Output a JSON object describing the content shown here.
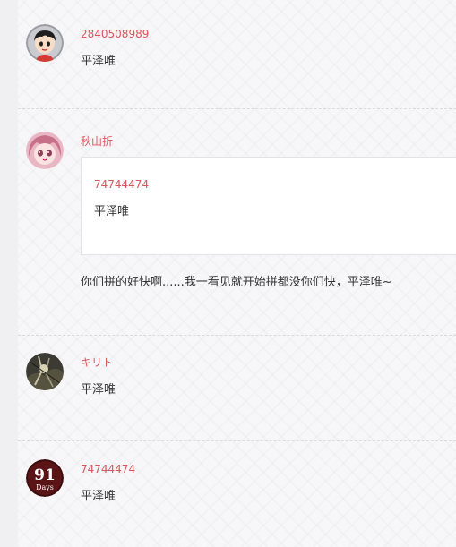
{
  "comments": [
    {
      "author": "2840508989",
      "text": "平泽唯",
      "avatar_icon": "cartoon-boy-avatar"
    },
    {
      "author": "秋山折",
      "quote": {
        "author": "74744474",
        "text": "平泽唯"
      },
      "text": "你们拼的好快啊......我一看见就开始拼都没你们快，平泽唯~",
      "avatar_icon": "anime-girl-avatar"
    },
    {
      "author": "キリト",
      "text": "平泽唯",
      "avatar_icon": "dark-photo-avatar"
    },
    {
      "author": "74744474",
      "text": "平泽唯",
      "avatar_icon": "91-days-logo-avatar",
      "avatar_logo": {
        "number": "91",
        "word": "Days"
      }
    }
  ],
  "colors": {
    "author": "#d8555b",
    "text": "#333333",
    "background": "#f7f7f9"
  }
}
